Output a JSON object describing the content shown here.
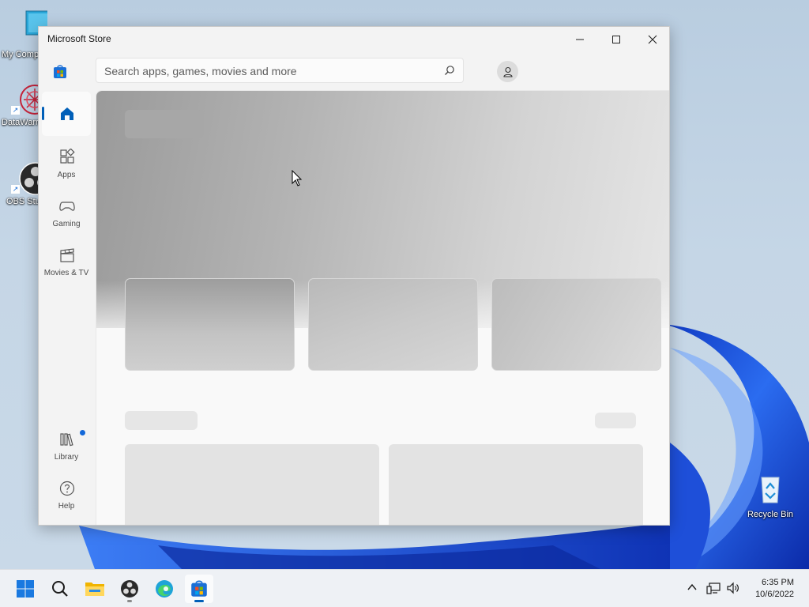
{
  "desktop": {
    "icons": [
      {
        "label": "My Computer"
      },
      {
        "label": "DataWarrior"
      },
      {
        "label": "OBS Studio"
      },
      {
        "label": "Recycle Bin"
      }
    ]
  },
  "window": {
    "title": "Microsoft Store",
    "search_placeholder": "Search apps, games, movies and more"
  },
  "nav": {
    "items": [
      {
        "label": "Home"
      },
      {
        "label": "Apps"
      },
      {
        "label": "Gaming"
      },
      {
        "label": "Movies & TV"
      },
      {
        "label": "Library"
      },
      {
        "label": "Help"
      }
    ]
  },
  "taskbar": {
    "time": "6:35 PM",
    "date": "10/6/2022"
  },
  "colors": {
    "accent": "#005fb8",
    "wallpaper_bloom": "#1d4fd8"
  }
}
